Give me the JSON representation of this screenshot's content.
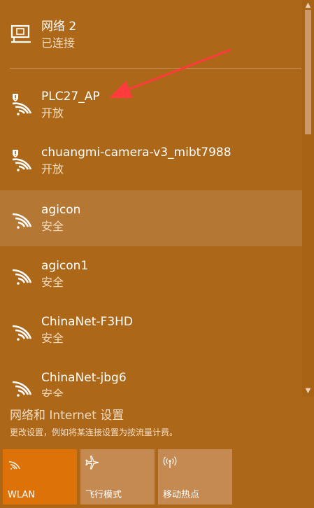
{
  "networks": [
    {
      "name": "网络 2",
      "status": "已连接",
      "icon": "ethernet-icon"
    },
    {
      "name": "PLC27_AP",
      "status": "开放",
      "icon": "wifi-open-warning-icon"
    },
    {
      "name": "chuangmi-camera-v3_mibt7988",
      "status": "开放",
      "icon": "wifi-open-warning-icon"
    },
    {
      "name": "agicon",
      "status": "安全",
      "icon": "wifi-icon"
    },
    {
      "name": "agicon1",
      "status": "安全",
      "icon": "wifi-icon"
    },
    {
      "name": "ChinaNet-F3HD",
      "status": "安全",
      "icon": "wifi-icon"
    },
    {
      "name": "ChinaNet-jbg6",
      "status": "安全",
      "icon": "wifi-icon"
    }
  ],
  "settings": {
    "link": "网络和 Internet 设置",
    "description": "更改设置，例如将某连接设置为按流量计费。"
  },
  "tiles": [
    {
      "label": "WLAN",
      "icon": "wifi-tile-icon",
      "active": true
    },
    {
      "label": "飞行模式",
      "icon": "airplane-icon",
      "active": false
    },
    {
      "label": "移动热点",
      "icon": "hotspot-icon",
      "active": false
    }
  ],
  "colors": {
    "background": "#ad6718",
    "hover_row": "#b57834",
    "active_tile": "#dc7208",
    "inactive_tile": "#c48a52",
    "arrow": "#ff3b3b"
  }
}
